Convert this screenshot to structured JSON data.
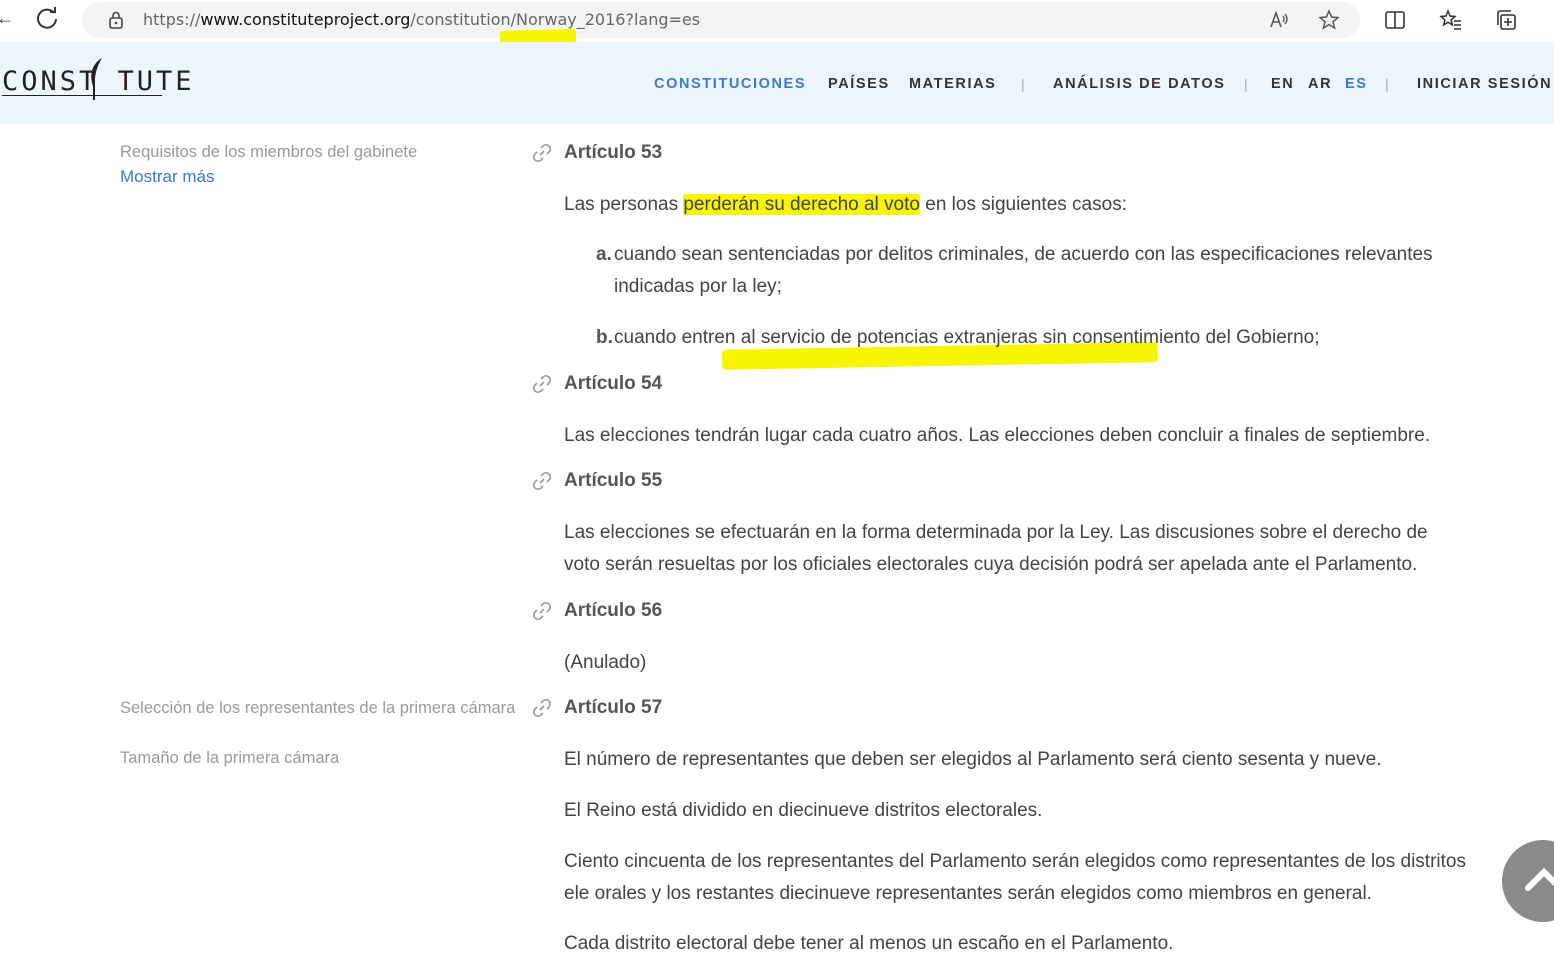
{
  "browser": {
    "url_prefix": "https://",
    "url_domain": "www.constituteproject.org",
    "url_path": "/constitution/Norway_2016?lang=es"
  },
  "header": {
    "logo": "CONST TUTE",
    "nav": [
      {
        "label": "CONSTITUCIONES",
        "active": true
      },
      {
        "label": "PAÍSES"
      },
      {
        "label": "MATERIAS"
      },
      {
        "label": "ANÁLISIS DE DATOS"
      },
      {
        "label": "EN"
      },
      {
        "label": "AR"
      },
      {
        "label": "ES",
        "active": true
      },
      {
        "label": "INICIAR SESIÓN"
      }
    ],
    "separator": "|"
  },
  "sidebar": {
    "topic_1": "Requisitos de los miembros del gabinete",
    "show_more": "Mostrar más",
    "topic_2": "Selección de los representantes de la primera cámara",
    "topic_3": "Tamaño de la primera cámara"
  },
  "articles": {
    "a53": {
      "title": "Artículo 53",
      "intro_before": "Las personas ",
      "intro_highlight": "perderán su derecho al voto",
      "intro_after": " en los siguientes casos:",
      "item_a_marker": "a.",
      "item_a": "cuando sean sentenciadas por delitos criminales, de acuerdo con las especificaciones relevantes indicadas por la ley;",
      "item_b_marker": "b.",
      "item_b": "cuando entren al servicio de potencias extranjeras sin consentimiento del Gobierno;"
    },
    "a54": {
      "title": "Artículo 54",
      "text": "Las elecciones tendrán lugar cada cuatro años. Las elecciones deben concluir a finales de septiembre."
    },
    "a55": {
      "title": "Artículo 55",
      "text": "Las elecciones se efectuarán en la forma determinada por la Ley. Las discusiones sobre el derecho de voto serán resueltas por los oficiales electorales cuya decisión podrá ser apelada ante el Parlamento."
    },
    "a56": {
      "title": "Artículo 56",
      "text": "(Anulado)"
    },
    "a57": {
      "title": "Artículo 57",
      "p1": "El número de representantes que deben ser elegidos al Parlamento será ciento sesenta y nueve.",
      "p2": "El Reino está dividido en diecinueve distritos electorales.",
      "p3": "Ciento cincuenta de los representantes del Parlamento serán elegidos como representantes de los distritos ele orales y los restantes diecinueve representantes serán elegidos como miembros en general.",
      "p4": "Cada distrito electoral debe tener al menos un escaño en el Parlamento."
    }
  },
  "colors": {
    "accent": "#3a7bc8",
    "highlight": "#f7f500",
    "header_bg": "#eef6fd"
  }
}
